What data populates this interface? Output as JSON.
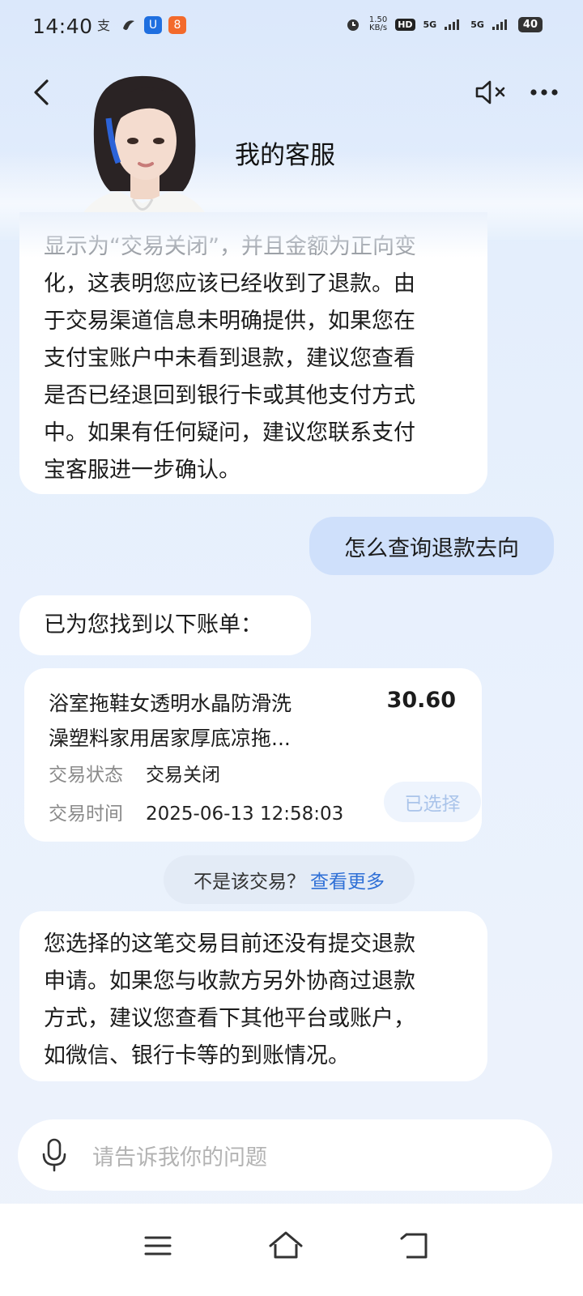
{
  "status_bar": {
    "time": "14:40",
    "net_speed_value": "1.50",
    "net_speed_unit": "KB/s",
    "hd_label": "HD",
    "signal1": "5G",
    "signal2": "5G",
    "battery": "40"
  },
  "header": {
    "title": "我的客服",
    "back_icon": "chevron-left-icon",
    "mute_icon": "speaker-muted-icon",
    "more_icon": "more-dots-icon"
  },
  "messages": {
    "bot1_lines": [
      "显示为“交易关闭”，并且金额为正向变",
      "化，这表明您应该已经收到了退款。由",
      "于交易渠道信息未明确提供，如果您在",
      "支付宝账户中未看到退款，建议您查看",
      "是否已经退回到银行卡或其他支付方式",
      "中。如果有任何疑问，建议您联系支付",
      "宝客服进一步确认。"
    ],
    "user1": "怎么查询退款去向",
    "bot2": "已为您找到以下账单：",
    "bill": {
      "title_line1": "浴室拖鞋女透明水晶防滑洗",
      "title_line2": "澡塑料家用居家厚底凉拖...",
      "amount": "30.60",
      "status_label": "交易状态",
      "status_value": "交易关闭",
      "time_label": "交易时间",
      "time_value": "2025-06-13 12:58:03",
      "selected_label": "已选择"
    },
    "not_this": {
      "question": "不是该交易？",
      "link": "查看更多"
    },
    "bot3_lines": [
      "您选择的这笔交易目前还没有提交退款",
      "申请。如果您与收款方另外协商过退款",
      "方式，建议您查看下其他平台或账户，",
      "如微信、银行卡等的到账情况。"
    ]
  },
  "input": {
    "placeholder": "请告诉我你的问题",
    "mic_icon": "microphone-icon"
  },
  "navbar": {
    "menu_icon": "menu-icon",
    "home_icon": "home-icon",
    "back_icon": "back-return-icon"
  },
  "colors": {
    "link": "#2e6fd6",
    "user_bubble": "#cfe0fb",
    "background": "#e6effc"
  }
}
